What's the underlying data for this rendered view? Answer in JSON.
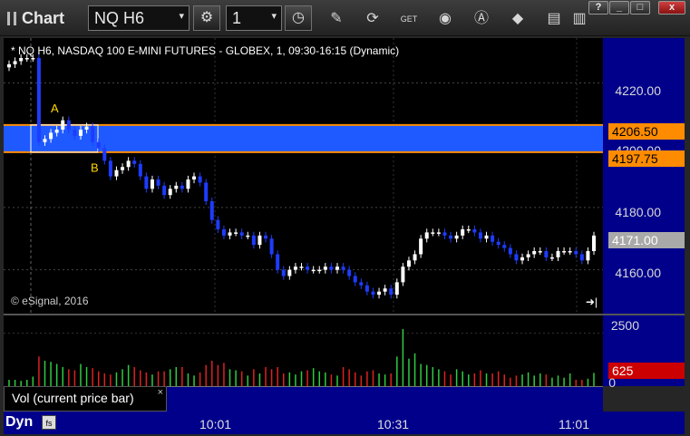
{
  "window": {
    "title": "Chart",
    "symbol_combo": "NQ H6",
    "interval_combo": "1",
    "buttons": [
      "?",
      "_",
      "□",
      "x"
    ]
  },
  "toolbar_icons": [
    "settings-icon",
    "clock-icon",
    "pencil-icon",
    "refresh-icon",
    "get-icon",
    "play-icon",
    "compass-icon",
    "eraser-icon",
    "comment-icon",
    "bar-icon"
  ],
  "chart": {
    "header": "* NQ H6, NASDAQ 100 E-MINI FUTURES - GLOBEX, 1, 09:30-16:15 (Dynamic)",
    "copyright": "© eSignal, 2016",
    "price_axis_labels": [
      "4220.00",
      "4200.00",
      "4180.00",
      "4160.00"
    ],
    "tags": [
      {
        "label": "4206.50",
        "color": "#ff8c00",
        "text_color": "#000000"
      },
      {
        "label": "4197.75",
        "color": "#ff8c00",
        "text_color": "#000000"
      },
      {
        "label": "4171.00",
        "color": "#a9a9a9",
        "text_color": "#ffffff"
      }
    ],
    "annotations": [
      {
        "label": "A"
      },
      {
        "label": "B"
      }
    ],
    "zone": {
      "top": 4206.5,
      "bottom": 4197.75,
      "color": "#1e5aff"
    },
    "colors": {
      "up": "#ffffff",
      "down": "#1e3cff",
      "background": "#000000"
    }
  },
  "volume": {
    "label": "Vol (current price bar)",
    "close_label": "×",
    "axis_labels": [
      "2500",
      "0"
    ],
    "current_tag": "625",
    "current_tag_color": "#cc0000"
  },
  "bottom": {
    "mode": "Dyn",
    "mode_icon": "fs",
    "time_labels": [
      "10:01",
      "10:31",
      "11:01"
    ]
  },
  "chart_data": {
    "type": "candlestick",
    "ylim": [
      4150,
      4228
    ],
    "price_ticks": [
      4220,
      4200,
      4180,
      4160
    ],
    "close": [
      4226,
      4227,
      4228,
      4228,
      4228,
      4201,
      4202,
      4204,
      4205,
      4208,
      4205,
      4203,
      4205,
      4206,
      4201,
      4199,
      4195,
      4190,
      4192,
      4193,
      4195,
      4194,
      4190,
      4186,
      4189,
      4187,
      4184,
      4186,
      4187,
      4186,
      4189,
      4190,
      4188,
      4182,
      4176,
      4173,
      4171,
      4172,
      4172,
      4171,
      4171,
      4168,
      4171,
      4170,
      4165,
      4160,
      4158,
      4160,
      4161,
      4161,
      4160,
      4160,
      4160,
      4161,
      4160,
      4161,
      4160,
      4158,
      4156,
      4155,
      4153,
      4152,
      4153,
      4154,
      4152,
      4156,
      4161,
      4163,
      4165,
      4170,
      4172,
      4172,
      4172,
      4171,
      4170,
      4171,
      4173,
      4173,
      4172,
      4170,
      4171,
      4169,
      4168,
      4167,
      4165,
      4163,
      4164,
      4165,
      4166,
      4166,
      4164,
      4164,
      4166,
      4166,
      4166,
      4165,
      4163,
      4166,
      4171
    ],
    "volume": [
      300,
      300,
      250,
      300,
      450,
      1400,
      1200,
      1150,
      1050,
      900,
      800,
      750,
      1050,
      900,
      850,
      700,
      600,
      550,
      650,
      800,
      1000,
      900,
      750,
      650,
      550,
      700,
      700,
      800,
      900,
      900,
      600,
      500,
      650,
      1000,
      1200,
      1000,
      1100,
      800,
      750,
      700,
      500,
      800,
      600,
      900,
      800,
      900,
      600,
      650,
      550,
      700,
      750,
      850,
      700,
      650,
      550,
      500,
      900,
      800,
      650,
      500,
      700,
      750,
      600,
      550,
      600,
      1400,
      2700,
      1300,
      1550,
      1050,
      1000,
      900,
      800,
      700,
      550,
      800,
      700,
      550,
      600,
      750,
      600,
      600,
      700,
      550,
      400,
      500,
      550,
      650,
      500,
      600,
      550,
      400,
      500,
      400,
      600,
      300,
      300,
      350,
      625
    ]
  }
}
